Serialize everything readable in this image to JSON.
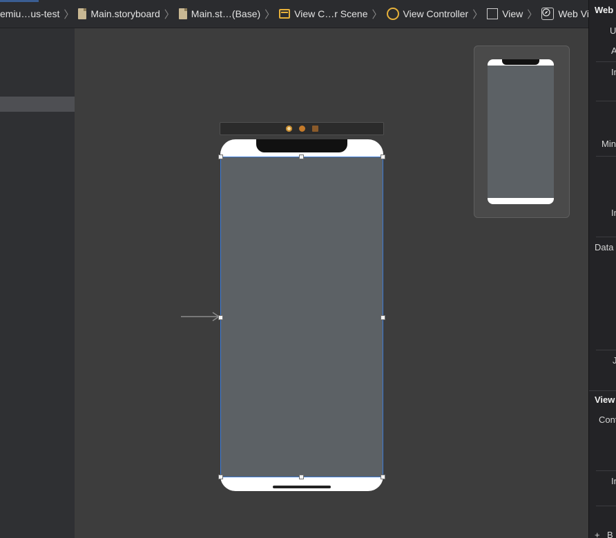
{
  "breadcrumb": {
    "items": [
      {
        "label": "emiu…us-test",
        "icon": "project-icon"
      },
      {
        "label": "Main.storyboard",
        "icon": "storyboard-file-icon"
      },
      {
        "label": "Main.st…(Base)",
        "icon": "storyboard-file-icon"
      },
      {
        "label": "View C…r Scene",
        "icon": "scene-icon"
      },
      {
        "label": "View Controller",
        "icon": "view-controller-icon"
      },
      {
        "label": "View",
        "icon": "view-icon"
      },
      {
        "label": "Web View",
        "icon": "web-view-icon"
      }
    ],
    "separator": "〉"
  },
  "inspector": {
    "section_web": "Web",
    "row_u": "U",
    "row_a": "A",
    "row_i1": "In",
    "row_min": "Min",
    "row_i2": "In",
    "section_data": "Data",
    "row_j": "J",
    "section_view": "View",
    "row_cont": "Cont",
    "row_i3": "In",
    "row_add": "+",
    "row_b": "B"
  },
  "canvas": {
    "scene_dock_icons": [
      "first-responder-icon",
      "view-controller-icon",
      "exit-icon"
    ],
    "device_icons": [
      "entry-point-arrow-icon"
    ],
    "colors": {
      "canvas_bg": "#3d3d3d",
      "webview_bg": "#5c6165",
      "selection": "#3d7bd6",
      "accent": "#e7b13a"
    }
  }
}
